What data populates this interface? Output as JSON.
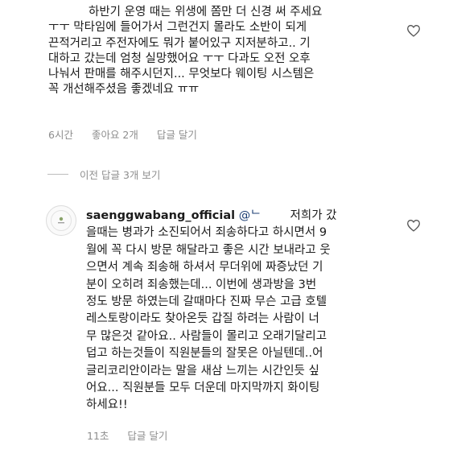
{
  "comment": {
    "lines": [
      "하반기 운영 때는 위생에 쫌만 더 신경 써 주세요",
      "ㅜㅜ 막타임에 들어가서 그런건지 몰라도 소반이 되게",
      "끈적거리고 주전자에도 뭐가 붙어있구 지저분하고.. 기",
      "대하고 갔는데 엄청 실망했어요 ㅜㅜ 다과도 오전 오후",
      "나눠서 판매를 해주시던지... 무엇보다 웨이팅 시스템은",
      "꼭 개선해주셨음 좋겠네요 ㅠㅠ"
    ],
    "time": "6시간",
    "likes": "좋아요 2개",
    "reply_label": "답글 달기"
  },
  "view_replies_label": "이전 답글 3개 보기",
  "reply": {
    "username": "saenggwabang_official",
    "mention": "@ᄂ",
    "lines_first": "저희가 갔",
    "lines": [
      "을때는 병과가 소진되어서 죄송하다고 하시면서 9",
      "월에 꼭 다시 방문 해달라고 좋은 시간 보내라고 웃",
      "으면서 계속 죄송해 하셔서 무더위에 짜증났던 기",
      "분이 오히려 죄송했는데... 이번에 생과방을 3번",
      "정도 방문 하였는데 갈때마다 진짜 무슨 고급 호텔",
      "레스토랑이라도 찾아온듯 갑질 하려는 사람이 너",
      "무 많은것 같아요.. 사람들이 몰리고 오래기달리고",
      "덥고 하는것들이 직원분들의 잘못은 아닐텐데..어",
      "글리코리안이라는 말을 새삼 느끼는 시간인듯 싶",
      "어요... 직원분들 모두 더운데 마지막까지 화이팅",
      "하세요!!"
    ],
    "time": "11초",
    "reply_label": "답글 달기"
  },
  "icons": {
    "heart": "heart-outline-icon",
    "avatar": "brand-logo-avatar"
  }
}
